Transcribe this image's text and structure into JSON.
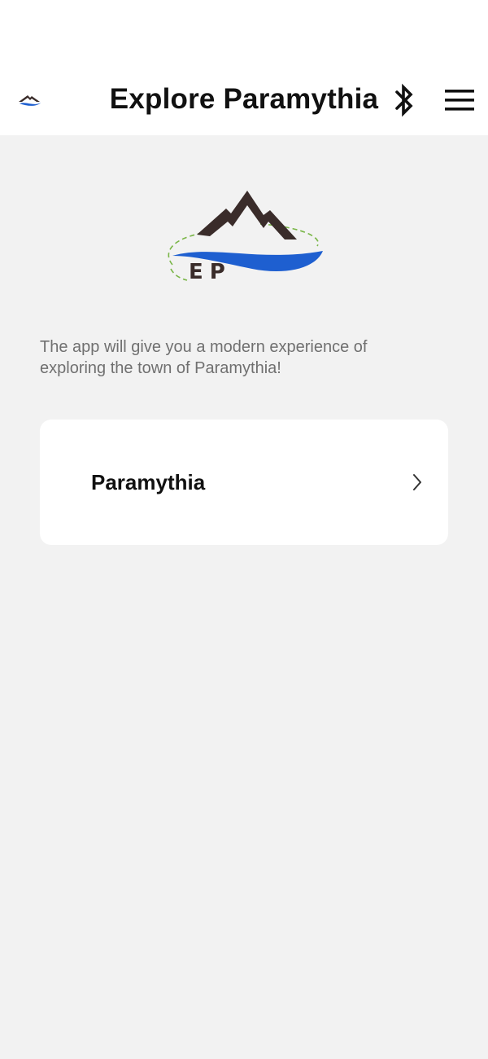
{
  "app_bar": {
    "title": "Explore Paramythia",
    "logo_icon": "mountain-logo-icon",
    "bluetooth_icon": "bluetooth-icon",
    "menu_icon": "hamburger-menu-icon"
  },
  "hero": {
    "logo_text": "EP",
    "logo_icon": "mountain-river-logo",
    "colors": {
      "mountain": "#3a2c2a",
      "river": "#1e5fd0",
      "dashes": "#7ab648",
      "letters": "#3a2c2a"
    }
  },
  "intro": {
    "text": "The app will give you a modern experience of exploring the town of Paramythia!"
  },
  "towns": [
    {
      "label": "Paramythia",
      "icon": "chevron-right-icon"
    }
  ]
}
